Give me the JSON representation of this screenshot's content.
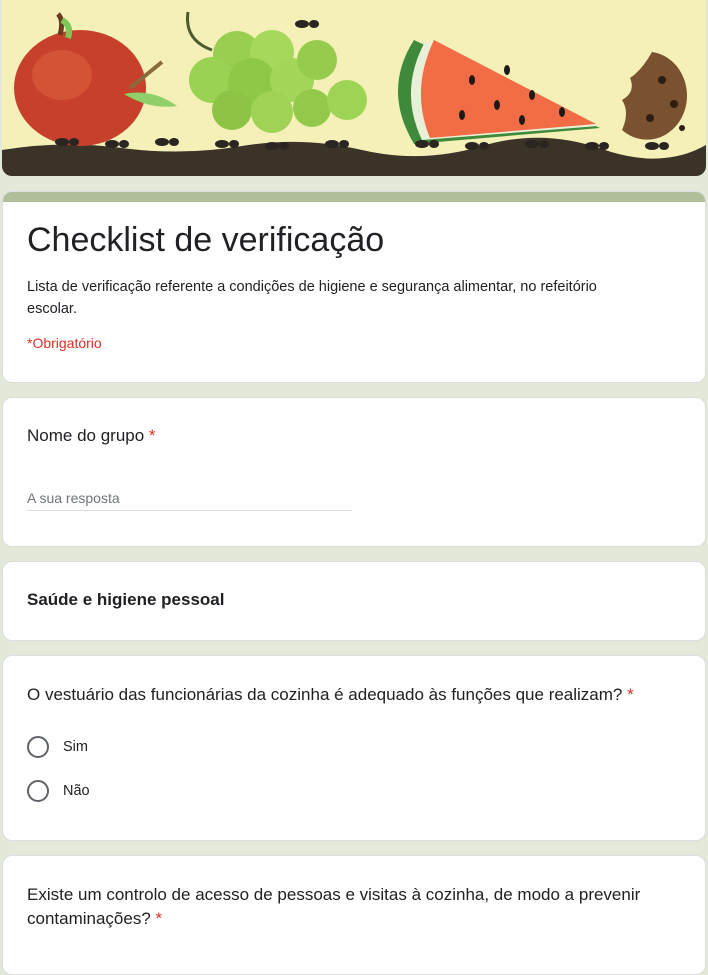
{
  "header": {
    "title": "Checklist de verificação",
    "description_line1": "Lista de verificação referente a condições de higiene e segurança alimentar, no refeitório",
    "description_line2": "escolar.",
    "required_note": "*Obrigatório"
  },
  "questions": {
    "group_name": {
      "label": "Nome do grupo",
      "required_mark": "*",
      "placeholder": "A sua resposta"
    },
    "section": {
      "title": "Saúde e higiene pessoal"
    },
    "clothing": {
      "label": "O vestuário das funcionárias da cozinha é adequado às funções que realizam?",
      "required_mark": "*",
      "options": [
        "Sim",
        "Não"
      ]
    },
    "access_control": {
      "label_line1": "Existe um controlo de acesso de pessoas e visitas à cozinha, de modo a prevenir",
      "label_line2": "contaminações?",
      "required_mark": "*"
    }
  },
  "colors": {
    "background": "#e4e8d8",
    "accent_bar": "#b1bf99",
    "required": "#d93025"
  },
  "icons": [
    "banner-illustration",
    "radio-button"
  ]
}
